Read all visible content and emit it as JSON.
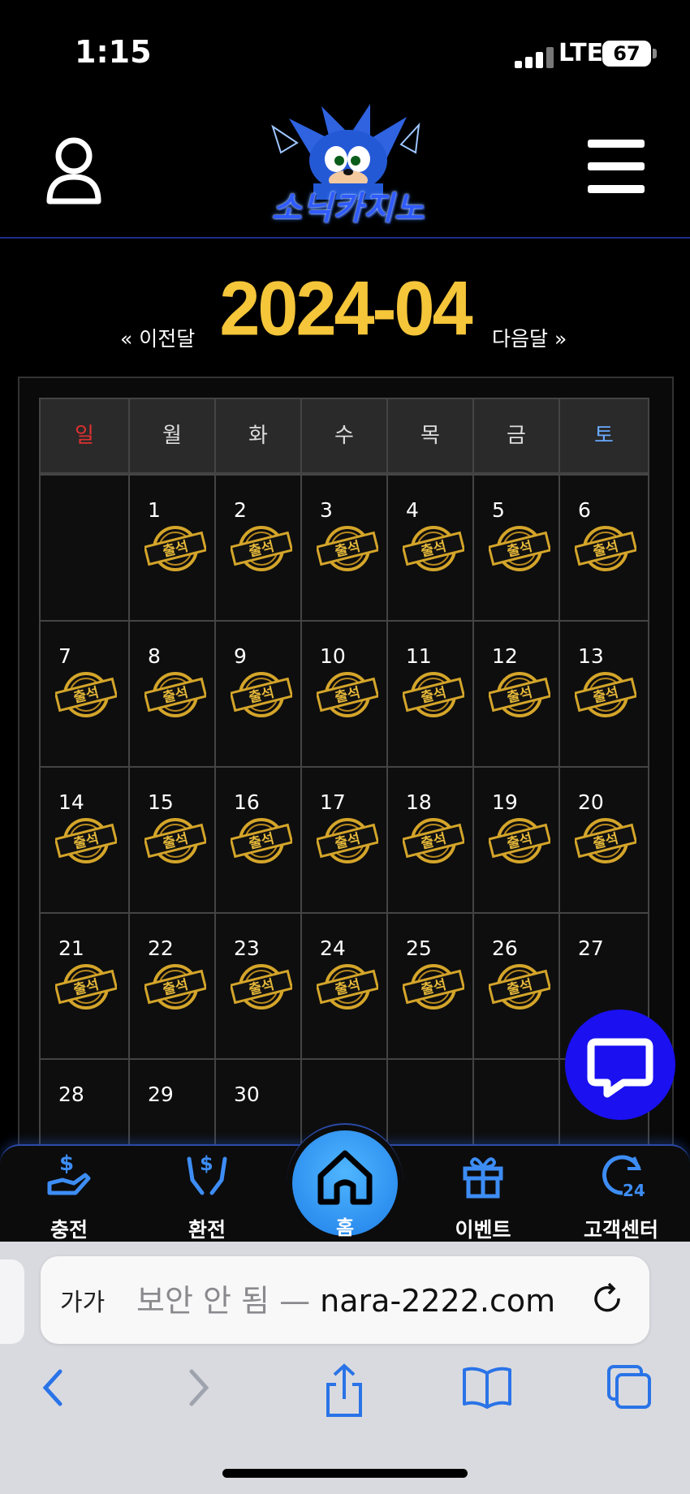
{
  "status": {
    "time": "1:15",
    "network": "LTE",
    "battery": "67"
  },
  "header": {
    "logo_text": "소닉카지노"
  },
  "calendar": {
    "prev_label": "« 이전달",
    "title": "2024-04",
    "next_label": "다음달 »",
    "weekdays": [
      "일",
      "월",
      "화",
      "수",
      "목",
      "금",
      "토"
    ],
    "weeks": [
      [
        {
          "day": "",
          "attended": false
        },
        {
          "day": "1",
          "attended": true
        },
        {
          "day": "2",
          "attended": true
        },
        {
          "day": "3",
          "attended": true
        },
        {
          "day": "4",
          "attended": true
        },
        {
          "day": "5",
          "attended": true
        },
        {
          "day": "6",
          "attended": true
        }
      ],
      [
        {
          "day": "7",
          "attended": true
        },
        {
          "day": "8",
          "attended": true
        },
        {
          "day": "9",
          "attended": true
        },
        {
          "day": "10",
          "attended": true
        },
        {
          "day": "11",
          "attended": true
        },
        {
          "day": "12",
          "attended": true
        },
        {
          "day": "13",
          "attended": true
        }
      ],
      [
        {
          "day": "14",
          "attended": true
        },
        {
          "day": "15",
          "attended": true
        },
        {
          "day": "16",
          "attended": true
        },
        {
          "day": "17",
          "attended": true
        },
        {
          "day": "18",
          "attended": true
        },
        {
          "day": "19",
          "attended": true
        },
        {
          "day": "20",
          "attended": true
        }
      ],
      [
        {
          "day": "21",
          "attended": true
        },
        {
          "day": "22",
          "attended": true
        },
        {
          "day": "23",
          "attended": true
        },
        {
          "day": "24",
          "attended": true
        },
        {
          "day": "25",
          "attended": true
        },
        {
          "day": "26",
          "attended": true
        },
        {
          "day": "27",
          "attended": false
        }
      ],
      [
        {
          "day": "28",
          "attended": false
        },
        {
          "day": "29",
          "attended": false
        },
        {
          "day": "30",
          "attended": false
        },
        {
          "day": "",
          "attended": false
        },
        {
          "day": "",
          "attended": false
        },
        {
          "day": "",
          "attended": false
        },
        {
          "day": "",
          "attended": false
        }
      ]
    ],
    "stamp_text": "출석"
  },
  "bottom_nav": {
    "deposit": "충전",
    "withdraw": "환전",
    "home": "홈",
    "event": "이벤트",
    "support": "고객센터"
  },
  "browser": {
    "aa_label": "가가",
    "insecure_label": "보안 안 됨 — ",
    "domain": "nara-2222.com"
  },
  "colors": {
    "accent_gold": "#f5c53a",
    "brand_blue": "#2f5bff",
    "chat_blue": "#1a10f0",
    "nav_blue": "#1f7ee8"
  }
}
